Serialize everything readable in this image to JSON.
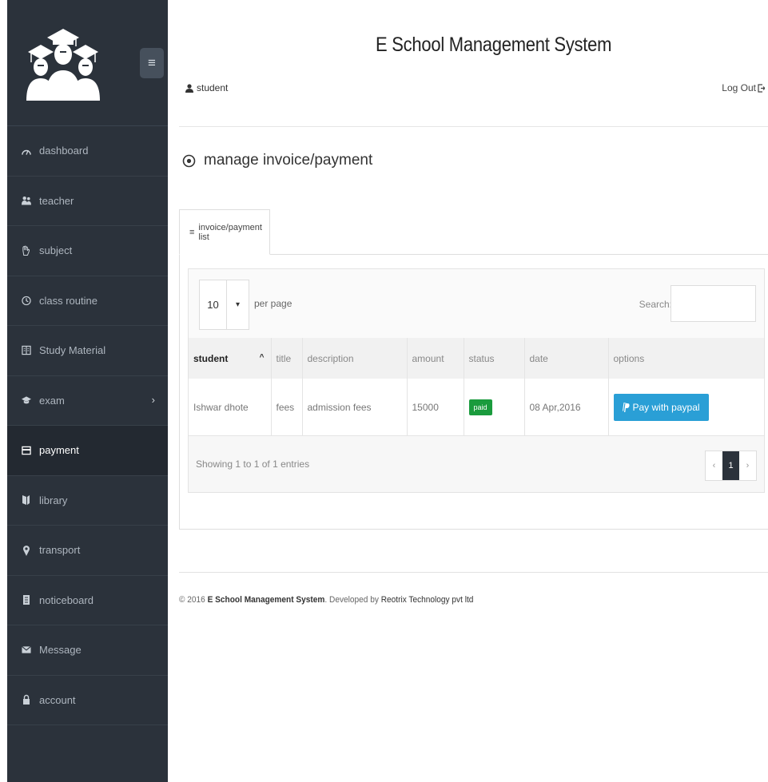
{
  "app": {
    "title": "E School Management System",
    "username": "student",
    "logout_label": "Log Out"
  },
  "sidebar": {
    "items": [
      {
        "label": "dashboard",
        "icon": "dashboard-icon"
      },
      {
        "label": "teacher",
        "icon": "users-icon"
      },
      {
        "label": "subject",
        "icon": "hand-icon"
      },
      {
        "label": "class routine",
        "icon": "clock-icon"
      },
      {
        "label": "Study Material",
        "icon": "book-icon"
      },
      {
        "label": "exam",
        "icon": "graduation-icon"
      },
      {
        "label": "payment",
        "icon": "card-icon",
        "active": true
      },
      {
        "label": "library",
        "icon": "library-icon"
      },
      {
        "label": "transport",
        "icon": "map-pin-icon"
      },
      {
        "label": "noticeboard",
        "icon": "notice-icon"
      },
      {
        "label": "Message",
        "icon": "envelope-icon"
      },
      {
        "label": "account",
        "icon": "lock-icon"
      }
    ]
  },
  "page": {
    "heading": "manage invoice/payment",
    "tab_label": "invoice/payment list"
  },
  "table": {
    "per_page_value": "10",
    "per_page_label": "per page",
    "search_label": "Search:",
    "search_placeholder": "",
    "columns": [
      "student",
      "title",
      "description",
      "amount",
      "status",
      "date",
      "options"
    ],
    "rows": [
      {
        "student": "Ishwar dhote",
        "title": "fees",
        "description": "admission fees",
        "amount": "15000",
        "status": "paid",
        "date": "08 Apr,2016",
        "option_label": "Pay with paypal"
      }
    ],
    "showing": "Showing 1 to 1 of 1 entries",
    "pager": {
      "prev": "‹",
      "current": "1",
      "next": "›"
    }
  },
  "footer": {
    "prefix": "© 2016",
    "system_name": "E School Management System",
    "developed_by": ". Developed by",
    "company": "Reotrix Technology pvt ltd"
  },
  "colors": {
    "sidebar_bg": "#2b323b",
    "accent_blue": "#2a9fd6",
    "paid_green": "#1a9b3d"
  }
}
